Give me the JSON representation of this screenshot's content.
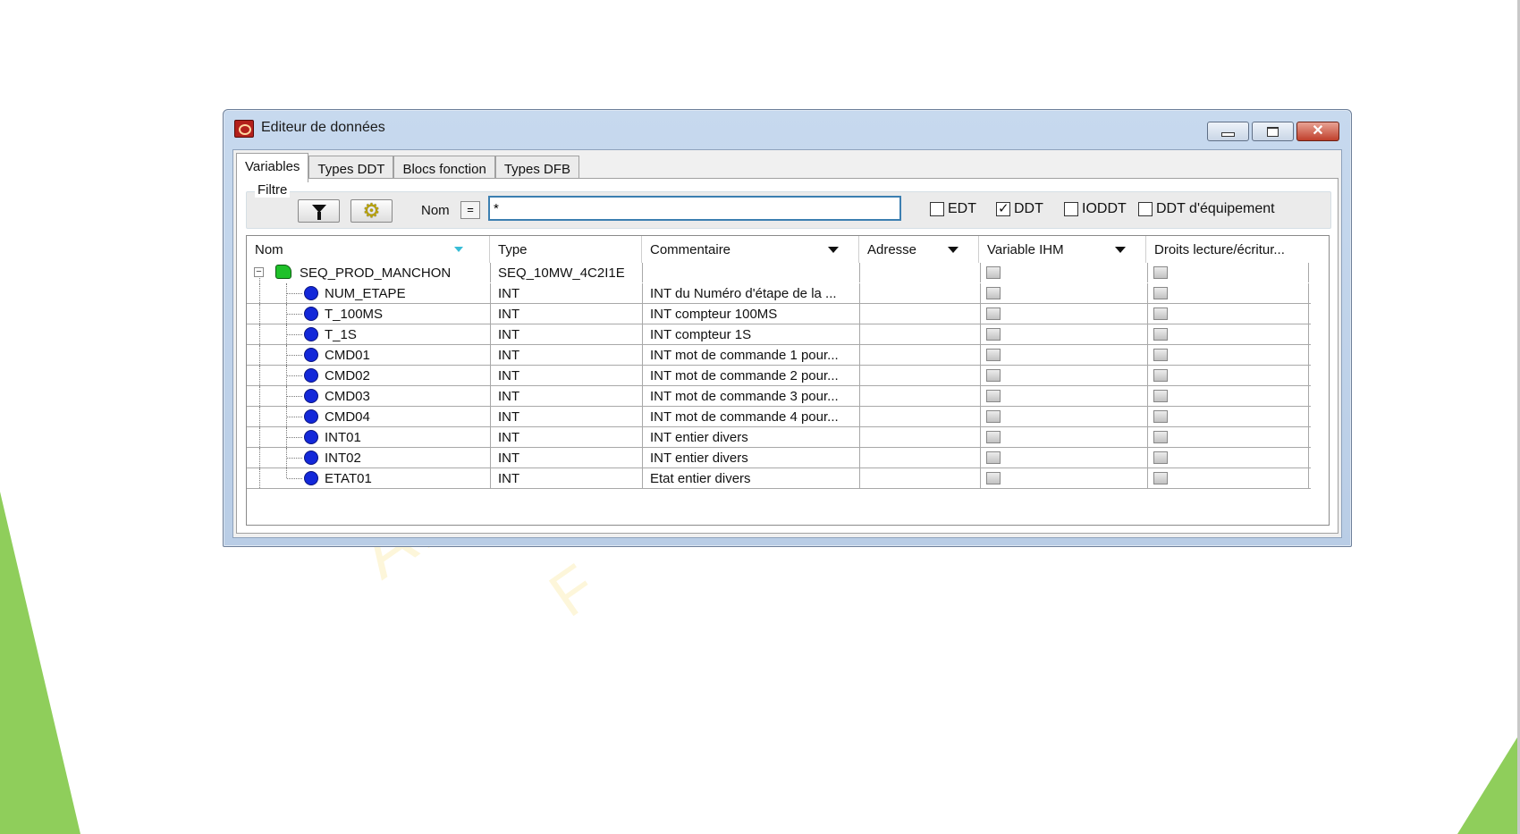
{
  "window": {
    "title": "Editeur de données"
  },
  "tabs": [
    "Variables",
    "Types DDT",
    "Blocs fonction",
    "Types DFB"
  ],
  "filter": {
    "legend": "Filtre",
    "nom_label": "Nom",
    "eq_label": "=",
    "search_value": "*",
    "checkboxes": [
      {
        "label": "EDT",
        "checked": false
      },
      {
        "label": "DDT",
        "checked": true
      },
      {
        "label": "IODDT",
        "checked": false
      },
      {
        "label": "DDT d'équipement",
        "checked": false
      }
    ]
  },
  "grid": {
    "columns": [
      "Nom",
      "Type",
      "Commentaire",
      "Adresse",
      "Variable IHM",
      "Droits lecture/écritur..."
    ],
    "root": {
      "name": "SEQ_PROD_MANCHON",
      "type": "SEQ_10MW_4C2I1E",
      "comment": "",
      "address": "",
      "icon": "structure-icon"
    },
    "children": [
      {
        "name": "NUM_ETAPE",
        "type": "INT",
        "comment": "INT du Numéro d'étape de la ...",
        "address": ""
      },
      {
        "name": "T_100MS",
        "type": "INT",
        "comment": "INT compteur 100MS",
        "address": ""
      },
      {
        "name": "T_1S",
        "type": "INT",
        "comment": "INT compteur 1S",
        "address": ""
      },
      {
        "name": "CMD01",
        "type": "INT",
        "comment": "INT mot de commande 1 pour...",
        "address": ""
      },
      {
        "name": "CMD02",
        "type": "INT",
        "comment": "INT mot de commande 2 pour...",
        "address": ""
      },
      {
        "name": "CMD03",
        "type": "INT",
        "comment": "INT mot de commande 3 pour...",
        "address": ""
      },
      {
        "name": "CMD04",
        "type": "INT",
        "comment": "INT mot de commande 4 pour...",
        "address": ""
      },
      {
        "name": "INT01",
        "type": "INT",
        "comment": "INT entier divers",
        "address": ""
      },
      {
        "name": "INT02",
        "type": "INT",
        "comment": "INT entier divers",
        "address": ""
      },
      {
        "name": "ETAT01",
        "type": "INT",
        "comment": "Etat entier divers",
        "address": ""
      }
    ]
  },
  "watermark": {
    "text1": "AEI",
    "text2": "F"
  },
  "colors": {
    "accent_green": "#8fce5b",
    "input_focus": "#3c7fb1",
    "element_blue": "#1328d9",
    "struct_green": "#1fc12a"
  }
}
